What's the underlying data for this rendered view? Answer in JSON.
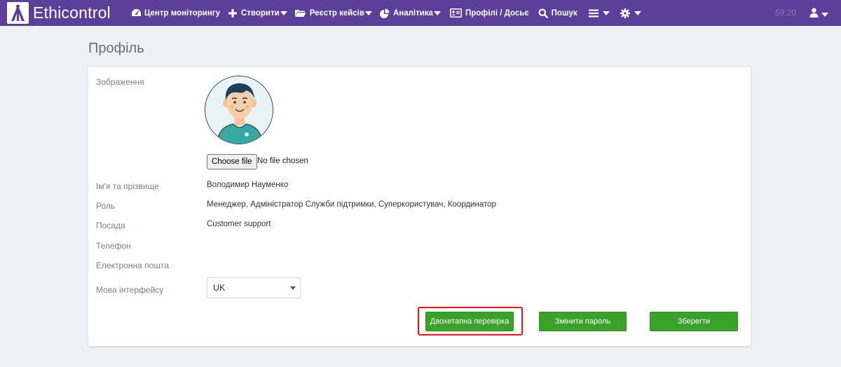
{
  "navbar": {
    "brand": "Ethicontrol",
    "items": [
      {
        "label": "Центр моніторингу",
        "icon": "dashboard-icon",
        "caret": false
      },
      {
        "label": "Створити",
        "icon": "plus-icon",
        "caret": true
      },
      {
        "label": "Реєстр кейсів",
        "icon": "folder-icon",
        "caret": true
      },
      {
        "label": "Аналітика",
        "icon": "pie-chart-icon",
        "caret": true
      },
      {
        "label": "Профілі / Досьє",
        "icon": "id-card-icon",
        "caret": false
      },
      {
        "label": "Пошук",
        "icon": "search-icon",
        "caret": false
      }
    ],
    "time": "59:20"
  },
  "page": {
    "title": "Профіль"
  },
  "profile": {
    "image_label": "Зображення",
    "choose_file_label": "Choose file",
    "file_status": "No file chosen",
    "name_label": "Ім'я та прізвище",
    "name_value": "Володимир Науменко",
    "role_label": "Роль",
    "role_value": "Менеджер, Адміністратор Служби підтримки, Суперкористувач, Координатор",
    "position_label": "Посада",
    "position_value": "Customer support",
    "phone_label": "Телефон",
    "phone_value": "",
    "email_label": "Електронна пошта",
    "email_value": "",
    "language_label": "Мова інтерфейсу",
    "language_value": "UK"
  },
  "actions": {
    "two_factor": "Двохетапна перевірка",
    "change_password": "Змінити пароль",
    "save": "Зберегти"
  },
  "colors": {
    "navbar": "#5c3f98",
    "button": "#3aa12b",
    "highlight": "#e0161c"
  }
}
